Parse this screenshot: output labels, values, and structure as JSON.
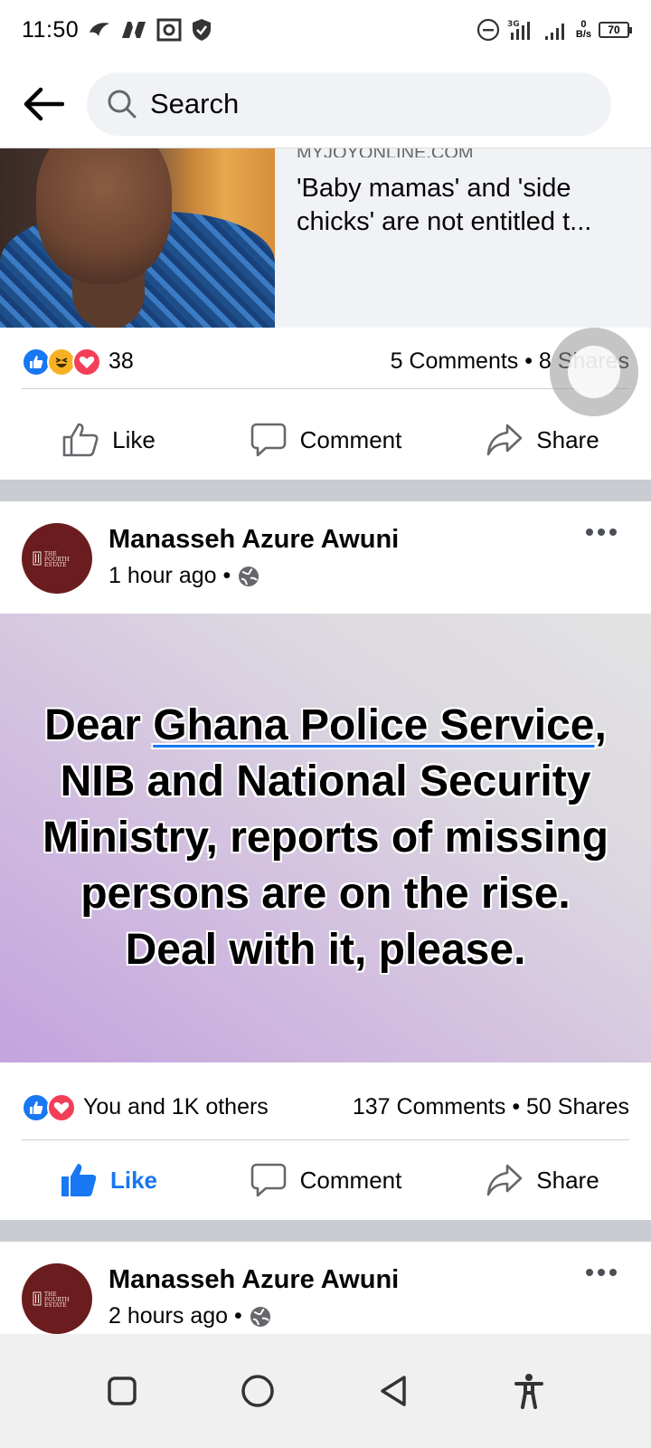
{
  "status_bar": {
    "time": "11:50",
    "battery": "70",
    "net_speed_value": "0",
    "net_speed_unit": "B/s"
  },
  "search": {
    "placeholder": "Search"
  },
  "link_post": {
    "domain": "MYJOYONLINE.COM",
    "title": "'Baby mamas' and 'side chicks' are not entitled t...",
    "reaction_count": "38",
    "stats": "5 Comments • 8 Shares"
  },
  "actions": {
    "like": "Like",
    "comment": "Comment",
    "share": "Share"
  },
  "post1": {
    "author": "Manasseh Azure Awuni",
    "time": "1 hour ago •",
    "avatar_text": "THE FOURTH ESTATE",
    "body_prefix": "Dear ",
    "body_link": "Ghana Police Service",
    "body_suffix": ", NIB and National Security Ministry, reports of missing persons are on the rise. Deal with it, please.",
    "reactions": "You and 1K others",
    "stats": "137 Comments • 50 Shares"
  },
  "post2": {
    "author": "Manasseh Azure Awuni",
    "time": "2 hours ago •",
    "avatar_text": "THE FOURTH ESTATE"
  },
  "colors": {
    "facebook_blue": "#1877f2",
    "love_red": "#f33e58",
    "haha_yellow": "#f7b125",
    "avatar_maroon": "#6b1c1e"
  }
}
